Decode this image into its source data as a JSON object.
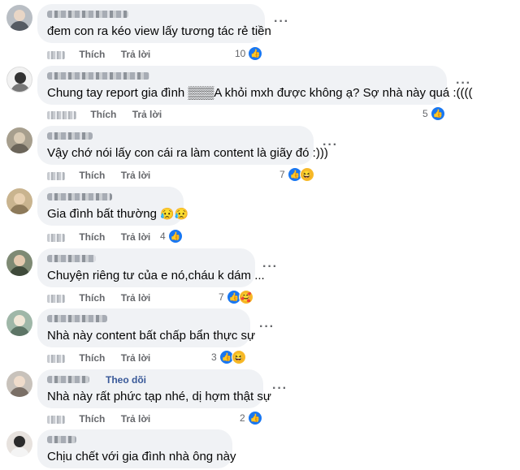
{
  "actions": {
    "like_label": "Thích",
    "reply_label": "Trả lời"
  },
  "colors": {
    "bubble": "#f0f2f5",
    "like_blue": "#1877f2",
    "meta_gray": "#65676b",
    "follow_link": "#385898"
  },
  "comments": [
    {
      "text": "đem con ra kéo view lấy tương tác rẻ tiền",
      "reaction_count": "10",
      "reactions": [
        "like"
      ]
    },
    {
      "text": "Chung tay report gia đình ▒▒▒A khỏi mxh được không ạ? Sợ nhà này quá :((((",
      "reaction_count": "5",
      "reactions": [
        "like"
      ]
    },
    {
      "text": "Vậy chớ nói lấy con cái ra làm content là giãy đó :)))",
      "reaction_count": "7",
      "reactions": [
        "like",
        "haha"
      ]
    },
    {
      "text": "Gia đình bất thường",
      "text_emojis": "😥😥",
      "reaction_count": "4",
      "reactions": [
        "like"
      ]
    },
    {
      "text": "Chuyện riêng tư của e nó,cháu k dám ...",
      "reaction_count": "7",
      "reactions": [
        "like",
        "care"
      ]
    },
    {
      "text": "Nhà này content bất chấp bẩn thực sự",
      "reaction_count": "3",
      "reactions": [
        "like",
        "haha"
      ]
    },
    {
      "text": "Nhà này rất phức tạp nhé, dị hợm thật sự",
      "follow_label": "Theo dõi",
      "reaction_count": "2",
      "reactions": [
        "like"
      ]
    },
    {
      "text": "Chịu chết với gia đình nhà ông này"
    }
  ],
  "icons": {
    "more": "more-horizontal-icon",
    "like": "like-reaction-icon",
    "haha": "haha-reaction-icon",
    "care": "care-reaction-icon"
  }
}
